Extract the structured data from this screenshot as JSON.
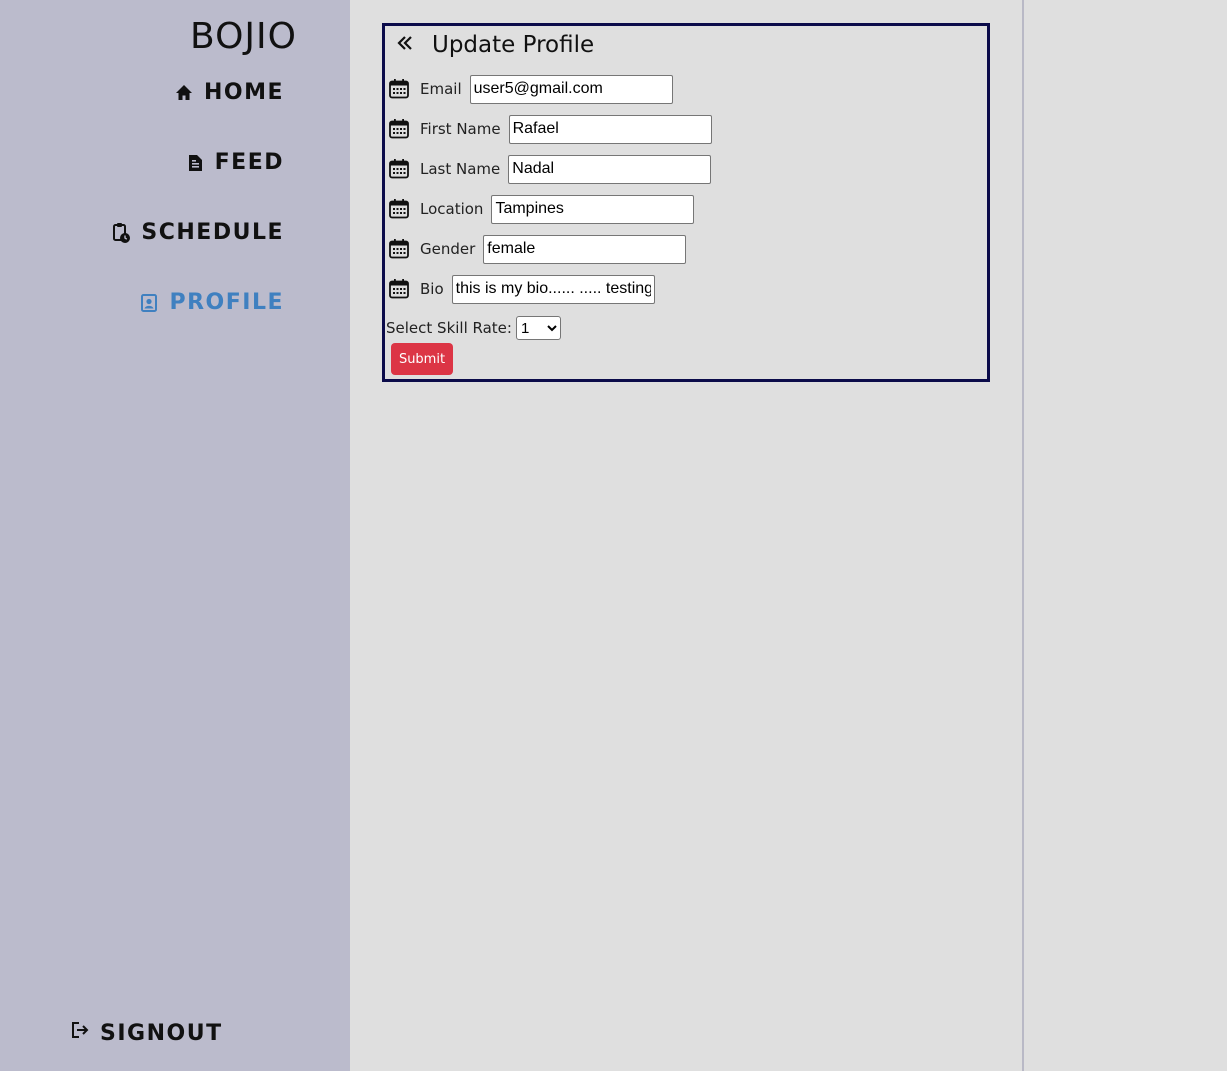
{
  "app": {
    "logo": "BOJIO"
  },
  "nav": {
    "home": "HOME",
    "feed": "FEED",
    "schedule": "SCHEDULE",
    "profile": "PROFILE",
    "signout": "SIGNOUT",
    "active": "PROFILE",
    "active_color": "#3f80c0"
  },
  "form": {
    "title": "Update Profile",
    "fields": {
      "email": {
        "label": "Email",
        "value": "user5@gmail.com"
      },
      "first_name": {
        "label": "First Name",
        "value": "Rafael"
      },
      "last_name": {
        "label": "Last Name",
        "value": "Nadal"
      },
      "location": {
        "label": "Location",
        "value": "Tampines"
      },
      "gender": {
        "label": "Gender",
        "value": "female"
      },
      "bio": {
        "label": "Bio",
        "value": "this is my bio...... ..... testing"
      }
    },
    "skill_label": "Select Skill Rate:",
    "skill_value": "1",
    "submit_label": "Submit",
    "submit_color": "#dc3545",
    "border_color": "#0b0b4a"
  },
  "icons": {
    "back": "double-chevron-left-icon",
    "field": "calendar-icon",
    "home": "home-icon",
    "feed": "document-icon",
    "schedule": "clipboard-clock-icon",
    "profile": "profile-badge-icon",
    "signout": "logout-icon"
  }
}
